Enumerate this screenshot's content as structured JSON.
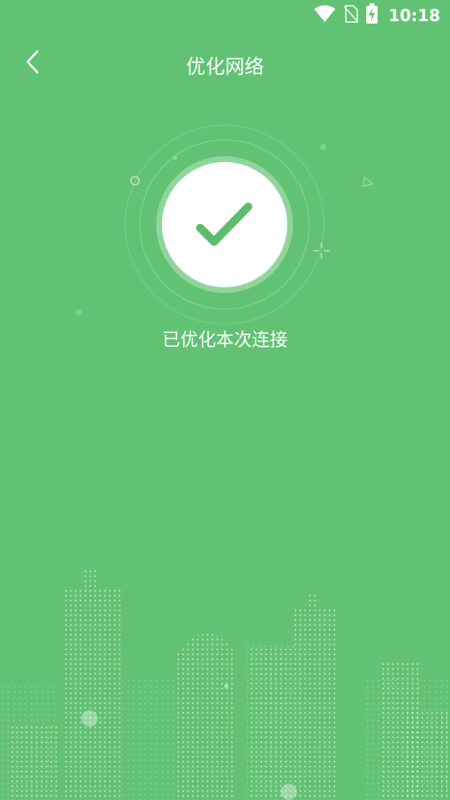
{
  "status_bar": {
    "time": "10:18",
    "icons": [
      "wifi-icon",
      "no-sim-icon",
      "battery-charging-icon"
    ]
  },
  "header": {
    "back_icon": "chevron-left-icon",
    "title": "优化网络"
  },
  "result": {
    "icon": "check-icon",
    "message": "已优化本次连接"
  },
  "colors": {
    "background": "#62c274",
    "check": "#5cbd6d",
    "circle": "#ffffff"
  }
}
